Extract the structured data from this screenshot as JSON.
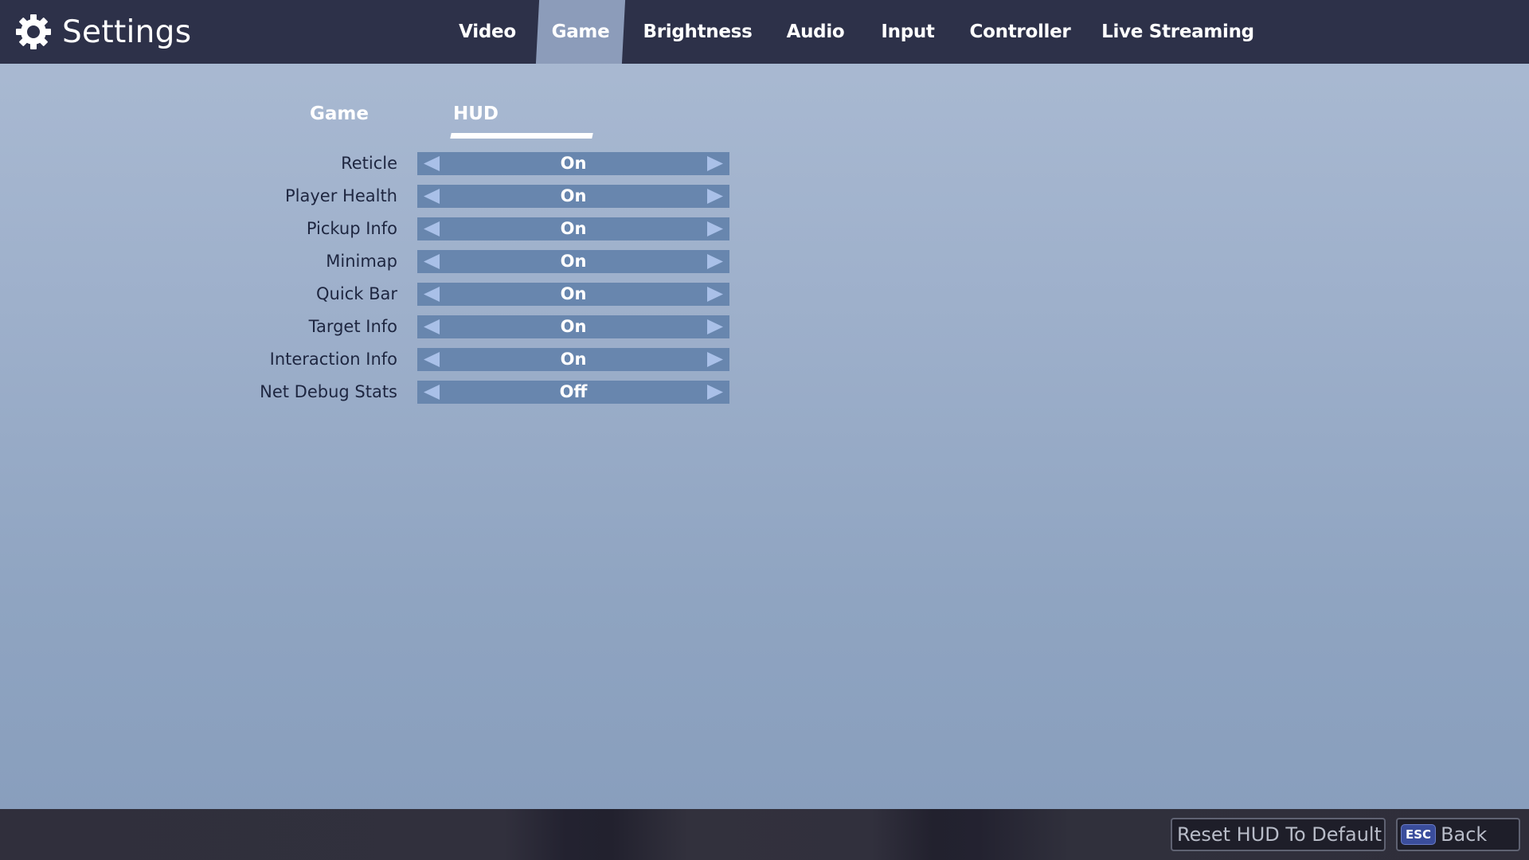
{
  "header": {
    "icon": "gear-icon",
    "title": "Settings",
    "tabs": [
      {
        "label": "Video",
        "active": false
      },
      {
        "label": "Game",
        "active": true
      },
      {
        "label": "Brightness",
        "active": false
      },
      {
        "label": "Audio",
        "active": false
      },
      {
        "label": "Input",
        "active": false
      },
      {
        "label": "Controller",
        "active": false
      },
      {
        "label": "Live Streaming",
        "active": false
      }
    ]
  },
  "subtabs": [
    {
      "label": "Game",
      "active": false
    },
    {
      "label": "HUD",
      "active": true
    }
  ],
  "settings": [
    {
      "label": "Reticle",
      "value": "On"
    },
    {
      "label": "Player Health",
      "value": "On"
    },
    {
      "label": "Pickup Info",
      "value": "On"
    },
    {
      "label": "Minimap",
      "value": "On"
    },
    {
      "label": "Quick Bar",
      "value": "On"
    },
    {
      "label": "Target Info",
      "value": "On"
    },
    {
      "label": "Interaction Info",
      "value": "On"
    },
    {
      "label": "Net Debug Stats",
      "value": "Off"
    }
  ],
  "footer": {
    "reset_label": "Reset HUD To Default",
    "back_key": "ESC",
    "back_label": "Back"
  },
  "colors": {
    "header_bg": "#2d3149",
    "active_tab_bg": "#8c9cba",
    "selector_bg": "#6886ae",
    "arrow_color": "#a9c0e8",
    "esc_key_bg": "#3a4d9c"
  }
}
